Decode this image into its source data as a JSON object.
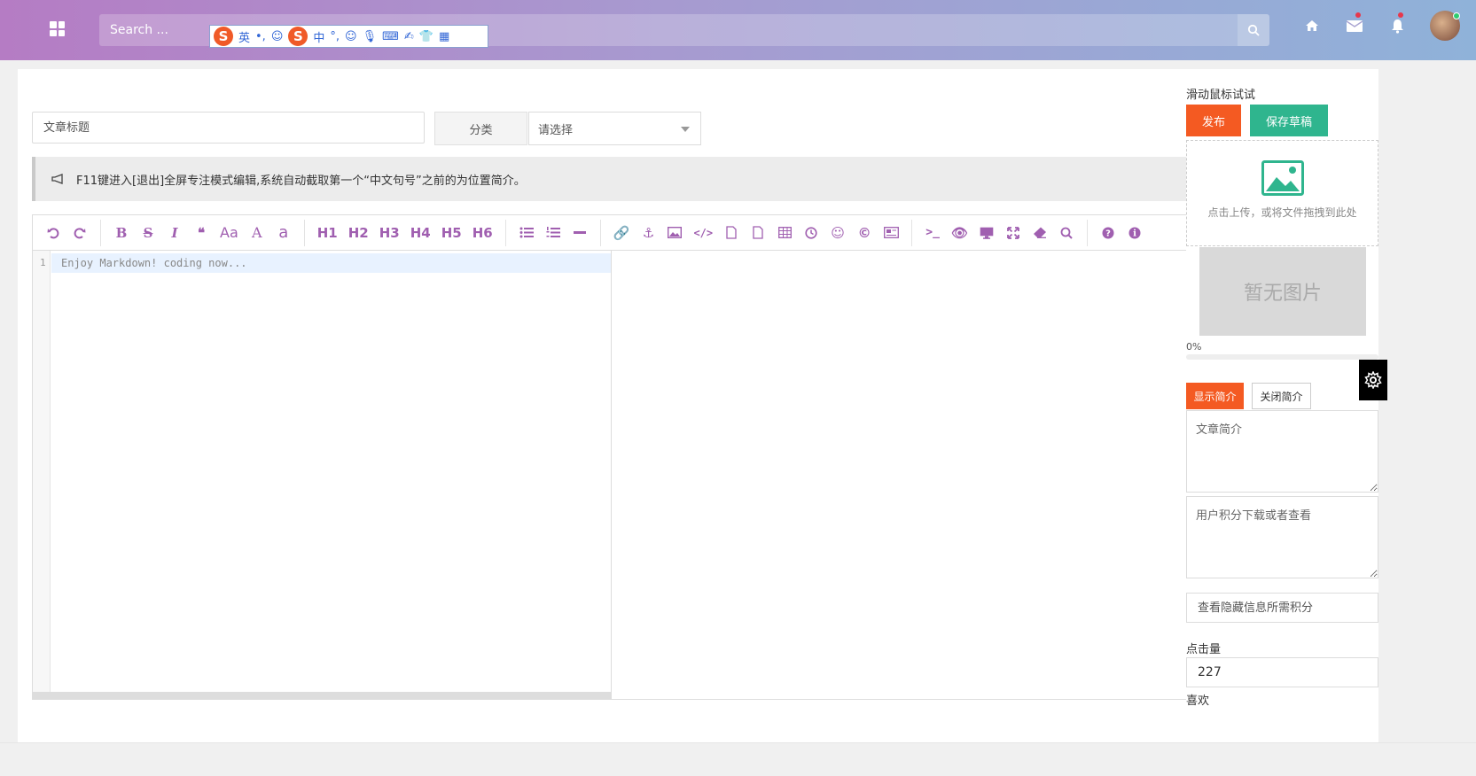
{
  "topbar": {
    "search_placeholder": "Search ...",
    "ime_labels": [
      "英",
      "中"
    ]
  },
  "form": {
    "title_placeholder": "文章标题",
    "category_label": "分类",
    "category_selected": "请选择",
    "notice": "F11键进入[退出]全屏专注模式编辑,系统自动截取第一个“中文句号”之前的为位置简介。"
  },
  "editor": {
    "toolbar_text_buttons": [
      "Aa",
      "A",
      "a",
      "H1",
      "H2",
      "H3",
      "H4",
      "H5",
      "H6"
    ],
    "line_number": "1",
    "code_placeholder": "Enjoy Markdown! coding now..."
  },
  "sidebar": {
    "hint": "滑动鼠标试试",
    "publish_label": "发布",
    "draft_label": "保存草稿",
    "upload_text": "点击上传，或将文件拖拽到此处",
    "no_image": "暂无图片",
    "progress_text": "0%",
    "progress_value": 0,
    "show_summary": "显示简介",
    "hide_summary": "关闭简介",
    "summary_placeholder": "文章简介",
    "points_placeholder": "用户积分下载或者查看",
    "hidden_points_placeholder": "查看隐藏信息所需积分",
    "clicks_label": "点击量",
    "clicks_value": "227",
    "likes_label": "喜欢"
  },
  "colors": {
    "accent_orange": "#f45a22",
    "accent_green": "#2fb58e",
    "toolbar_icon": "#a05fb0"
  }
}
